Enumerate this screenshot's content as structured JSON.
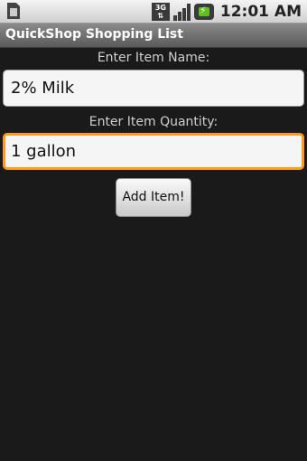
{
  "status_bar": {
    "network_label": "3G",
    "time": "12:01 AM",
    "icons": [
      "sd-card-icon",
      "network-3g-icon",
      "signal-icon",
      "battery-charging-icon"
    ]
  },
  "app": {
    "title": "QuickShop Shopping List"
  },
  "form": {
    "item_name_label": "Enter Item Name:",
    "item_name_value": "2% Milk",
    "item_quantity_label": "Enter Item Quantity:",
    "item_quantity_value": "1 gallon",
    "add_button_label": "Add Item!"
  },
  "colors": {
    "focus_border": "#ff9a1a",
    "background": "#1a1a1a"
  }
}
